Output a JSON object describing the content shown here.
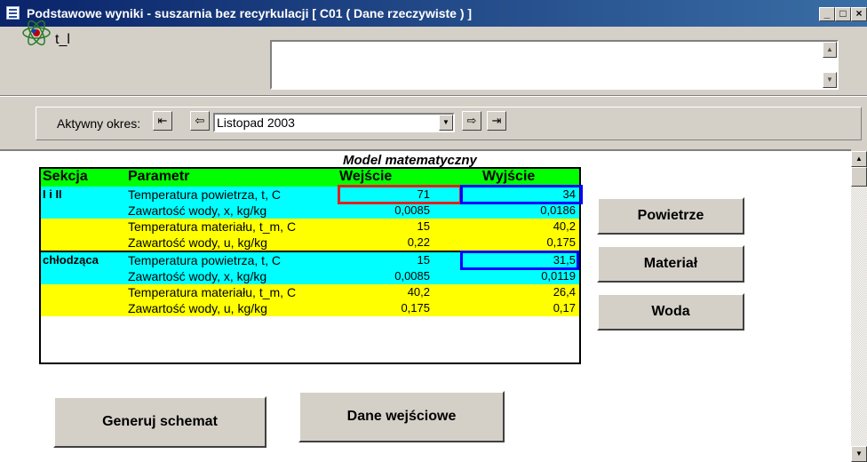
{
  "window": {
    "title": "Podstawowe wyniki - suszarnia bez recyrkulacji [ C01 ( Dane rzeczywiste ) ]",
    "min_label": "_",
    "max_label": "□",
    "close_label": "×"
  },
  "header": {
    "variable_label": "t_l",
    "info_text": ""
  },
  "navigation": {
    "period_label": "Aktywny okres:",
    "first_icon": "⇤",
    "prev_icon": "⇦",
    "next_icon": "⇨",
    "last_icon": "⇥",
    "period_value": "Listopad 2003",
    "dropdown_icon": "▼"
  },
  "model": {
    "title": "Model matematyczny",
    "columns": {
      "section": "Sekcja",
      "parameter": "Parametr",
      "input": "Wejście",
      "output": "Wyjście"
    },
    "rows": [
      {
        "section": "I i II",
        "parameter": "Temperatura powietrza, t, C",
        "input": "71",
        "output": "34"
      },
      {
        "section": "",
        "parameter": "Zawartość wody, x, kg/kg",
        "input": "0,0085",
        "output": "0,0186"
      },
      {
        "section": "",
        "parameter": "Temperatura materiału, t_m, C",
        "input": "15",
        "output": "40,2"
      },
      {
        "section": "",
        "parameter": "Zawartość wody, u, kg/kg",
        "input": "0,22",
        "output": "0,175"
      },
      {
        "section": "chłodząca",
        "parameter": "Temperatura powietrza, t, C",
        "input": "15",
        "output": "31,5"
      },
      {
        "section": "",
        "parameter": "Zawartość wody, x, kg/kg",
        "input": "0,0085",
        "output": "0,0119"
      },
      {
        "section": "",
        "parameter": "Temperatura materiału, t_m, C",
        "input": "40,2",
        "output": "26,4"
      },
      {
        "section": "",
        "parameter": "Zawartość wody, u, kg/kg",
        "input": "0,175",
        "output": "0,17"
      }
    ]
  },
  "buttons": {
    "powietrze": "Powietrze",
    "material": "Materiał",
    "woda": "Woda",
    "generuj": "Generuj schemat",
    "dane": "Dane wejściowe"
  },
  "icons": {
    "app": "form-icon",
    "variable": "atom-icon",
    "scroll_up": "arrow-up-icon",
    "scroll_down": "arrow-down-icon"
  },
  "colors": {
    "header_row": "#00ff00",
    "air_rows": "#00ffff",
    "material_rows": "#ffff00",
    "input_highlight": "#e02020",
    "output_highlight": "#0000ff"
  }
}
